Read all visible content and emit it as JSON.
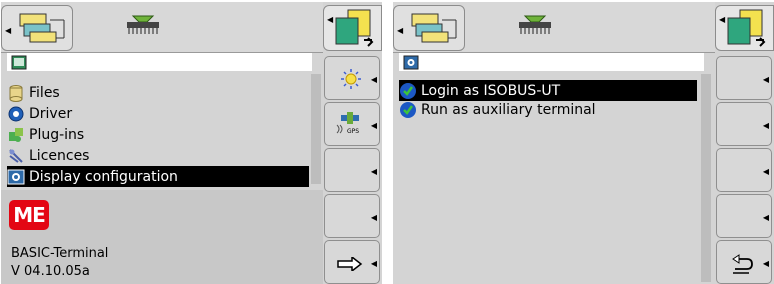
{
  "left": {
    "menu_items": [
      {
        "label": "Files",
        "icon": "files-icon"
      },
      {
        "label": "Driver",
        "icon": "driver-gear-icon"
      },
      {
        "label": "Plug-ins",
        "icon": "plugins-puzzle-icon"
      },
      {
        "label": "Licences",
        "icon": "licences-icon"
      },
      {
        "label": "Display configuration",
        "icon": "display-configuration-icon",
        "selected": true
      }
    ],
    "logo_text": "ME",
    "device_name": "BASIC-Terminal",
    "version": "V 04.10.05a",
    "side_buttons": [
      "sun-brightness-icon",
      "gps-icon",
      "",
      "",
      "forward-arrow-icon"
    ],
    "gps_label": "GPS"
  },
  "right": {
    "menu_items": [
      {
        "label": "Login as ISOBUS-UT",
        "icon": "check-icon",
        "selected": true
      },
      {
        "label": "Run as auxiliary terminal",
        "icon": "check-icon"
      }
    ],
    "side_buttons": [
      "",
      "",
      "",
      "",
      "return-icon"
    ]
  },
  "colors": {
    "selection": "#000000",
    "logo": "#e30613",
    "check": "#1c58c4",
    "check_mark": "#3cc43c"
  }
}
